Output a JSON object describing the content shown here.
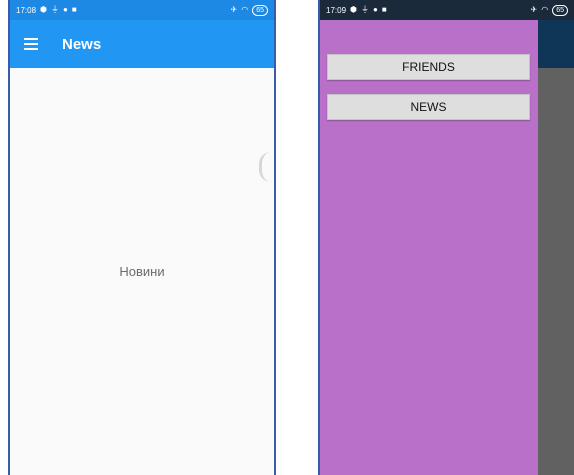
{
  "left": {
    "status": {
      "time": "17:08",
      "battery": "65"
    },
    "appbar": {
      "title": "News"
    },
    "content": {
      "text": "Новини"
    }
  },
  "right": {
    "status": {
      "time": "17:09",
      "battery": "65"
    },
    "drawer": {
      "items": [
        {
          "label": "FRIENDS"
        },
        {
          "label": "NEWS"
        }
      ]
    }
  },
  "colors": {
    "appbar": "#2196f3",
    "statusbar": "#1e88e5",
    "drawer": "#b870c8",
    "scrim": "#616161"
  }
}
